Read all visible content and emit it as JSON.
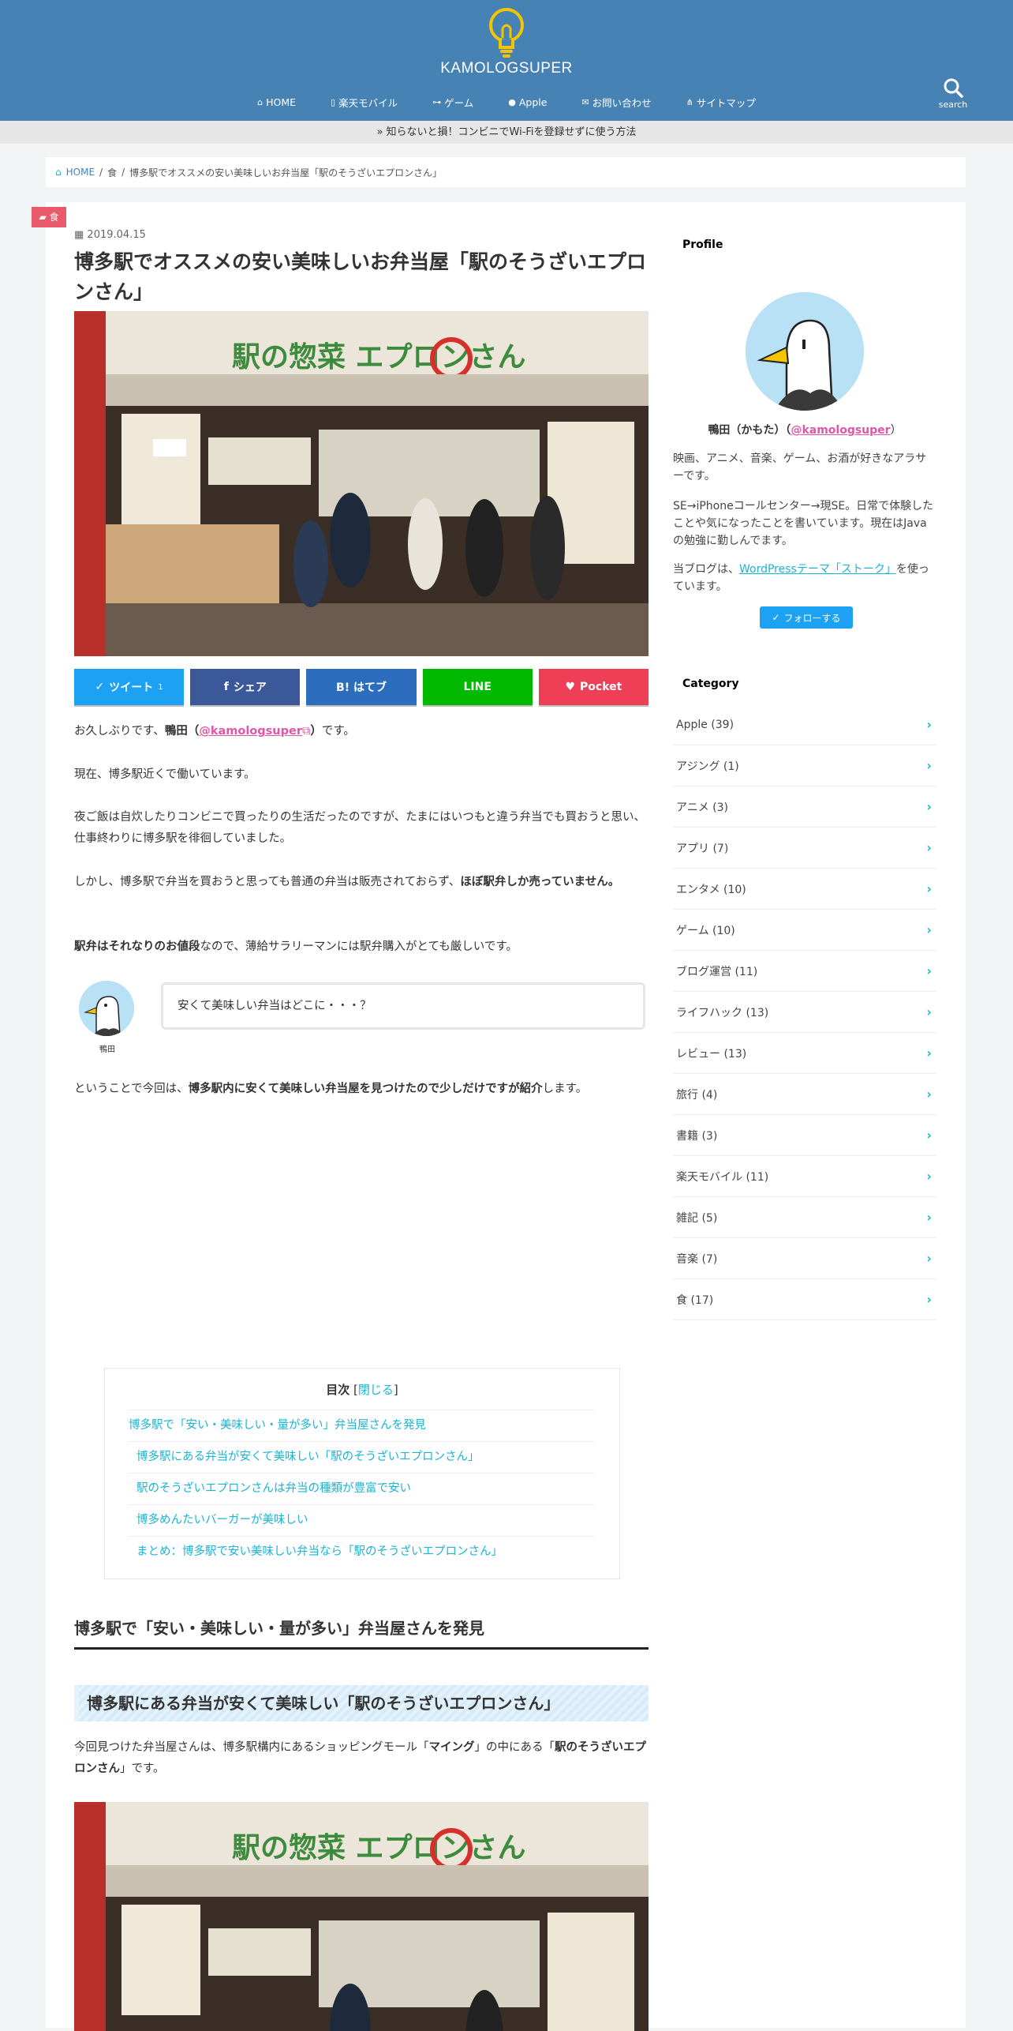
{
  "header": {
    "site_name": "KAMOLOGSUPER",
    "nav": [
      {
        "icon": "home-icon",
        "glyph": "⌂",
        "label": "HOME"
      },
      {
        "icon": "mobile-icon",
        "glyph": "▯",
        "label": "楽天モバイル"
      },
      {
        "icon": "gamepad-icon",
        "glyph": "⊶",
        "label": "ゲーム"
      },
      {
        "icon": "apple-icon",
        "glyph": "●",
        "label": "Apple"
      },
      {
        "icon": "envelope-icon",
        "glyph": "✉",
        "label": "お問い合わせ"
      },
      {
        "icon": "sitemap-icon",
        "glyph": "⋔",
        "label": "サイトマップ"
      }
    ],
    "search_label": "search"
  },
  "notice": "» 知らないと損！コンビニでWi-Fiを登録せずに使う方法",
  "breadcrumb": {
    "home": "HOME",
    "category": "食",
    "current": "博多駅でオススメの安い美味しいお弁当屋「駅のそうざいエプロンさん」"
  },
  "article": {
    "category_tag": "食",
    "date": "2019.04.15",
    "title": "博多駅でオススメの安い美味しいお弁当屋「駅のそうざいエプロンさん」",
    "sign_main": "駅の惣菜 エプロンさん",
    "share": [
      {
        "label": "ツイート",
        "glyph": "✓",
        "color": "#1da1f2",
        "extra": "1"
      },
      {
        "label": "シェア",
        "glyph": "f",
        "color": "#3b5998",
        "extra": ""
      },
      {
        "label": "B! はてブ",
        "glyph": "",
        "color": "#2c6ebd",
        "extra": ""
      },
      {
        "label": "LINE",
        "glyph": "",
        "color": "#00b900",
        "extra": ""
      },
      {
        "label": "Pocket",
        "glyph": "♥",
        "color": "#ef3f56",
        "extra": ""
      }
    ],
    "p1_a": "お久しぶりです、",
    "p1_b": "鴨田（",
    "p1_link": "@kamologsuper",
    "p1_c": "）",
    "p1_d": "です。",
    "p2": "現在、博多駅近くで働いています。",
    "p3": "夜ご飯は自炊したりコンビニで買ったりの生活だったのですが、たまにはいつもと違う弁当でも買おうと思い、仕事終わりに博多駅を徘徊していました。",
    "p4_a": "しかし、博多駅で弁当を買おうと思っても普通の弁当は販売されておらず、",
    "p4_b": "ほぼ駅弁しか売っていません。",
    "p5_a": "駅弁はそれなりのお値段",
    "p5_b": "なので、薄給サラリーマンには駅弁購入がとても厳しいです。",
    "chat_name": "鴨田",
    "chat_text": "安くて美味しい弁当はどこに・・・？",
    "p6_a": "ということで今回は、",
    "p6_b": "博多駅内に安くて美味しい弁当屋を見つけたので少しだけですが紹介",
    "p6_c": "します。",
    "toc": {
      "title": "目次",
      "close_open": " [",
      "close": "閉じる",
      "close_end": "]",
      "items": [
        {
          "text": "博多駅で「安い・美味しい・量が多い」弁当屋さんを発見",
          "sub": false
        },
        {
          "text": "博多駅にある弁当が安くて美味しい「駅のそうざいエプロンさん」",
          "sub": true
        },
        {
          "text": "駅のそうざいエプロンさんは弁当の種類が豊富で安い",
          "sub": true
        },
        {
          "text": "博多めんたいバーガーが美味しい",
          "sub": true
        },
        {
          "text": "まとめ：博多駅で安い美味しい弁当なら「駅のそうざいエプロンさん」",
          "sub": true
        }
      ]
    },
    "h2": "博多駅で「安い・美味しい・量が多い」弁当屋さんを発見",
    "h3": "博多駅にある弁当が安くて美味しい「駅のそうざいエプロンさん」",
    "p7_a": "今回見つけた弁当屋さんは、博多駅構内にあるショッピングモール「",
    "p7_b": "マイング",
    "p7_c": "」の中にある「",
    "p7_d": "駅のそうざいエプロンさん",
    "p7_e": "」です。"
  },
  "sidebar": {
    "profile_heading": "Profile",
    "name_a": "鴨田（かもた）（",
    "name_link": "@kamologsuper",
    "name_b": "）",
    "bio1": "映画、アニメ、音楽、ゲーム、お酒が好きなアラサーです。",
    "bio2": "SE→iPhoneコールセンター→現SE。日常で体験したことや気になったことを書いています。現在はJavaの勉強に勤しんでます。",
    "bio3_a": "当ブログは、",
    "bio3_link": "WordPressテーマ「ストーク」",
    "bio3_b": "を使っています。",
    "follow": "フォローする",
    "category_heading": "Category",
    "categories": [
      "Apple (39)",
      "アジング (1)",
      "アニメ (3)",
      "アプリ (7)",
      "エンタメ (10)",
      "ゲーム (10)",
      "ブログ運営 (11)",
      "ライフハック (13)",
      "レビュー (13)",
      "旅行 (4)",
      "書籍 (3)",
      "楽天モバイル (11)",
      "雑記 (5)",
      "音楽 (7)",
      "食 (17)"
    ]
  },
  "colors": {
    "header": "#4682b4",
    "accent": "#1bb4d3",
    "link_pink": "#e056a8",
    "tag": "#e95b6b"
  }
}
